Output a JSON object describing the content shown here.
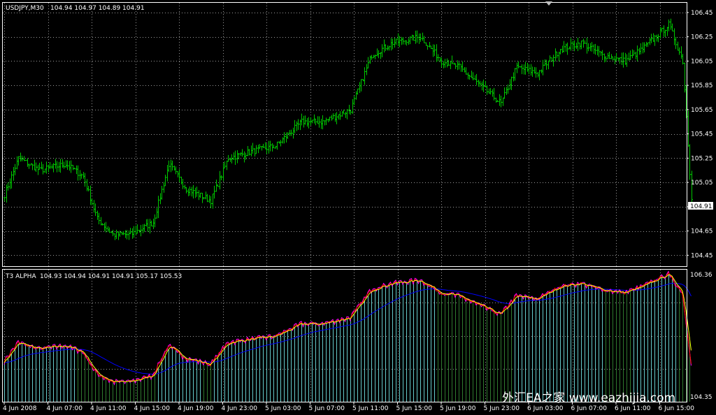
{
  "chart_data": [
    {
      "type": "ohlc",
      "title": "USDJPY,M30",
      "ohlc_readout": "104.94 104.97 104.89 104.91",
      "current_price": 104.91,
      "current_price_label": "104.91",
      "y_ticks": [
        "104.45",
        "104.65",
        "104.85",
        "105.05",
        "105.25",
        "105.45",
        "105.65",
        "105.85",
        "106.05",
        "106.25",
        "106.45"
      ],
      "ylim": [
        104.36,
        106.53
      ],
      "grid": true,
      "colors": {
        "bars": "#00c800",
        "grid": "#c0c0c0",
        "background": "#000000"
      },
      "values_anchor": [
        [
          0,
          104.95
        ],
        [
          8,
          105.25
        ],
        [
          20,
          105.15
        ],
        [
          35,
          105.2
        ],
        [
          45,
          105.1
        ],
        [
          53,
          104.75
        ],
        [
          62,
          104.62
        ],
        [
          72,
          104.62
        ],
        [
          85,
          104.72
        ],
        [
          94,
          105.2
        ],
        [
          104,
          105.0
        ],
        [
          118,
          104.9
        ],
        [
          128,
          105.25
        ],
        [
          140,
          105.3
        ],
        [
          155,
          105.35
        ],
        [
          170,
          105.55
        ],
        [
          182,
          105.55
        ],
        [
          190,
          105.6
        ],
        [
          198,
          105.65
        ],
        [
          210,
          106.1
        ],
        [
          222,
          106.2
        ],
        [
          238,
          106.25
        ],
        [
          250,
          106.05
        ],
        [
          260,
          106.0
        ],
        [
          272,
          105.85
        ],
        [
          284,
          105.7
        ],
        [
          293,
          106.0
        ],
        [
          305,
          105.95
        ],
        [
          318,
          106.15
        ],
        [
          330,
          106.2
        ],
        [
          342,
          106.1
        ],
        [
          355,
          106.05
        ],
        [
          365,
          106.15
        ],
        [
          380,
          106.35
        ],
        [
          388,
          106.05
        ],
        [
          393,
          104.91
        ]
      ]
    },
    {
      "type": "indicator",
      "title": "T3 ALPHA",
      "readout": "104.93 104.94 104.91 104.91 105.17 105.53",
      "price_label": "106.36",
      "bottom_label": "104.35",
      "colors": {
        "price_line": "#ff0000",
        "fast_line": "#ffff00",
        "alt_line": "#ff00ff",
        "slow_line": "#0000ff",
        "hist_green": "#2f7a2f",
        "hist_cyan": "#66cccc"
      },
      "ylim": [
        104.3,
        106.42
      ]
    }
  ],
  "x_ticks": [
    {
      "index": 0,
      "label": "4 Jun 2008"
    },
    {
      "index": 25,
      "label": "4 Jun 07:00"
    },
    {
      "index": 50,
      "label": "4 Jun 11:00"
    },
    {
      "index": 75,
      "label": "4 Jun 15:00"
    },
    {
      "index": 100,
      "label": "4 Jun 19:00"
    },
    {
      "index": 125,
      "label": "4 Jun 23:00"
    },
    {
      "index": 150,
      "label": "5 Jun 03:00"
    },
    {
      "index": 175,
      "label": "5 Jun 07:00"
    },
    {
      "index": 200,
      "label": "5 Jun 11:00"
    },
    {
      "index": 225,
      "label": "5 Jun 15:00"
    },
    {
      "index": 250,
      "label": "5 Jun 19:00"
    },
    {
      "index": 275,
      "label": "5 Jun 23:00"
    },
    {
      "index": 300,
      "label": "6 Jun 03:00"
    },
    {
      "index": 325,
      "label": "6 Jun 07:00"
    },
    {
      "index": 350,
      "label": "6 Jun 11:00"
    },
    {
      "index": 375,
      "label": "6 Jun 15:00"
    }
  ],
  "watermark": "外汇EA之家 www.eazhijia.com"
}
